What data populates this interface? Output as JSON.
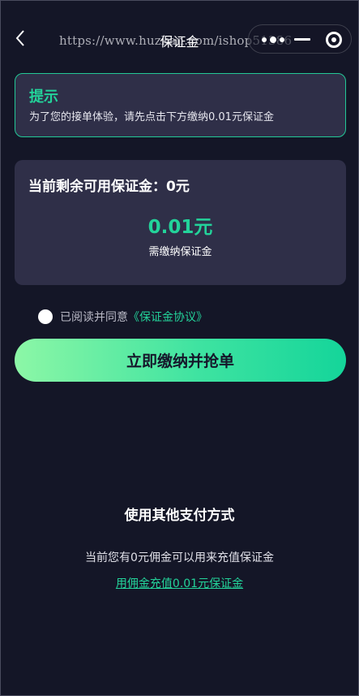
{
  "header": {
    "title": "保证金",
    "watermark": "https://www.huzkan.com/ishop51386"
  },
  "tip": {
    "title": "提示",
    "text": "为了您的接单体验，请先点击下方缴纳0.01元保证金"
  },
  "deposit": {
    "available": "当前剩余可用保证金：0元",
    "amount": "0.01元",
    "amount_label": "需缴纳保证金"
  },
  "agreement": {
    "prefix": "已阅读并同意",
    "link": "《保证金协议》"
  },
  "pay_button": "立即缴纳并抢单",
  "other_payment": {
    "title": "使用其他支付方式",
    "description": "当前您有0元佣金可以用来充值保证金",
    "link": "用佣金充值0.01元保证金"
  },
  "colors": {
    "background": "#141627",
    "card": "#2f2f48",
    "accent": "#23d39a"
  }
}
